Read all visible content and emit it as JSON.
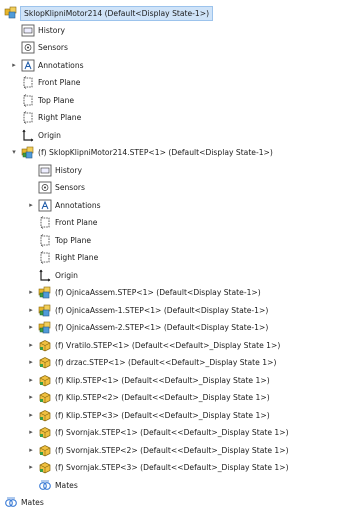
{
  "tree": {
    "root": {
      "label": "SklopKlipniMotor214  (Default<Display State-1>)",
      "icon": "assembly-icon"
    },
    "items": [
      {
        "label": "History",
        "icon": "history-icon",
        "level": 1,
        "caret": ""
      },
      {
        "label": "Sensors",
        "icon": "sensors-icon",
        "level": 1,
        "caret": ""
      },
      {
        "label": "Annotations",
        "icon": "annotations-icon",
        "level": 1,
        "caret": "▸"
      },
      {
        "label": "Front Plane",
        "icon": "plane-icon",
        "level": 1,
        "caret": ""
      },
      {
        "label": "Top Plane",
        "icon": "plane-icon",
        "level": 1,
        "caret": ""
      },
      {
        "label": "Right Plane",
        "icon": "plane-icon",
        "level": 1,
        "caret": ""
      },
      {
        "label": "Origin",
        "icon": "origin-icon",
        "level": 1,
        "caret": ""
      },
      {
        "label": "(f) SklopKlipniMotor214.STEP<1> (Default<Display State-1>)",
        "icon": "assembly-icon",
        "level": 1,
        "caret": "▾"
      },
      {
        "label": "History",
        "icon": "history-icon",
        "level": 2,
        "caret": ""
      },
      {
        "label": "Sensors",
        "icon": "sensors-icon",
        "level": 2,
        "caret": ""
      },
      {
        "label": "Annotations",
        "icon": "annotations-icon",
        "level": 2,
        "caret": "▸"
      },
      {
        "label": "Front Plane",
        "icon": "plane-icon",
        "level": 2,
        "caret": ""
      },
      {
        "label": "Top Plane",
        "icon": "plane-icon",
        "level": 2,
        "caret": ""
      },
      {
        "label": "Right Plane",
        "icon": "plane-icon",
        "level": 2,
        "caret": ""
      },
      {
        "label": "Origin",
        "icon": "origin-icon",
        "level": 2,
        "caret": ""
      },
      {
        "label": "(f) OjnicaAssem.STEP<1> (Default<Display State-1>)",
        "icon": "assembly-icon",
        "level": 2,
        "caret": "▸"
      },
      {
        "label": "(f) OjnicaAssem-1.STEP<1> (Default<Display State-1>)",
        "icon": "assembly-icon",
        "level": 2,
        "caret": "▸"
      },
      {
        "label": "(f) OjnicaAssem-2.STEP<1> (Default<Display State-1>)",
        "icon": "assembly-icon",
        "level": 2,
        "caret": "▸"
      },
      {
        "label": "(f) Vratilo.STEP<1> (Default<<Default>_Display State 1>)",
        "icon": "part-icon",
        "level": 2,
        "caret": "▸"
      },
      {
        "label": "(f) drzac.STEP<1> (Default<<Default>_Display State 1>)",
        "icon": "part-icon",
        "level": 2,
        "caret": "▸"
      },
      {
        "label": "(f) Klip.STEP<1> (Default<<Default>_Display State 1>)",
        "icon": "part-icon",
        "level": 2,
        "caret": "▸"
      },
      {
        "label": "(f) Klip.STEP<2> (Default<<Default>_Display State 1>)",
        "icon": "part-icon",
        "level": 2,
        "caret": "▸"
      },
      {
        "label": "(f) Klip.STEP<3> (Default<<Default>_Display State 1>)",
        "icon": "part-icon",
        "level": 2,
        "caret": "▸"
      },
      {
        "label": "(f) Svornjak.STEP<1> (Default<<Default>_Display State 1>)",
        "icon": "part-icon",
        "level": 2,
        "caret": "▸"
      },
      {
        "label": "(f) Svornjak.STEP<2> (Default<<Default>_Display State 1>)",
        "icon": "part-icon",
        "level": 2,
        "caret": "▸"
      },
      {
        "label": "(f) Svornjak.STEP<3> (Default<<Default>_Display State 1>)",
        "icon": "part-icon",
        "level": 2,
        "caret": "▸"
      },
      {
        "label": "Mates",
        "icon": "mates-icon",
        "level": 2,
        "caret": ""
      },
      {
        "label": "Mates",
        "icon": "mates-icon",
        "level": 0,
        "caret": ""
      }
    ]
  },
  "colors": {
    "selection": "#cfe3f8",
    "assembly": "#e8b62a",
    "part": "#e2a21b",
    "accent": "#2e7d32"
  }
}
